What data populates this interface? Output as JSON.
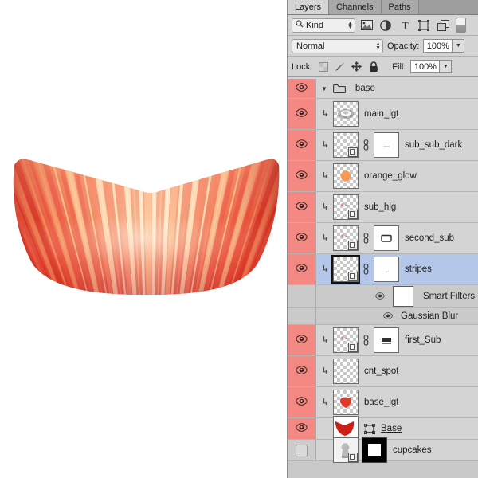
{
  "panel": {
    "tabs": [
      {
        "label": "Layers",
        "active": true
      },
      {
        "label": "Channels",
        "active": false
      },
      {
        "label": "Paths",
        "active": false
      }
    ],
    "filter": {
      "kind_label": "Kind",
      "search_icon": "magnifier-icon",
      "icons": [
        "image-filter-icon",
        "adjustment-filter-icon",
        "type-filter-icon",
        "shape-filter-icon",
        "smart-object-filter-icon"
      ],
      "toggle_name": "filter-enable-toggle"
    },
    "blend": {
      "mode": "Normal",
      "opacity_label": "Opacity:",
      "opacity_value": "100%",
      "fill_label": "Fill:",
      "fill_value": "100%"
    },
    "lock": {
      "label": "Lock:",
      "items": [
        "lock-transparent-pixels-icon",
        "lock-image-pixels-icon",
        "lock-position-icon",
        "lock-all-icon"
      ]
    }
  },
  "layers": [
    {
      "name": "base",
      "type": "group",
      "visible": true,
      "expanded": true,
      "clipped": false,
      "selected": false
    },
    {
      "name": "main_lgt",
      "type": "layer",
      "visible": true,
      "clipped": true,
      "selected": false,
      "has_thumb": true,
      "thumb_kind": "blurred-highlight",
      "smart_object": false,
      "linked": false,
      "has_mask": false
    },
    {
      "name": "sub_sub_dark",
      "type": "layer",
      "visible": true,
      "clipped": true,
      "selected": false,
      "has_thumb": true,
      "thumb_kind": "transparent",
      "smart_object": true,
      "linked": true,
      "has_mask": true,
      "mask_kind": "white-thin-line"
    },
    {
      "name": "orange_glow",
      "type": "layer",
      "visible": true,
      "clipped": true,
      "selected": false,
      "has_thumb": true,
      "thumb_kind": "orange-blob",
      "smart_object": false,
      "linked": false,
      "has_mask": false
    },
    {
      "name": "sub_hlg",
      "type": "layer",
      "visible": true,
      "clipped": true,
      "selected": false,
      "has_thumb": true,
      "thumb_kind": "faint-specks",
      "smart_object": true,
      "linked": false,
      "has_mask": false
    },
    {
      "name": "second_sub",
      "type": "layer",
      "visible": true,
      "clipped": true,
      "selected": false,
      "has_thumb": true,
      "thumb_kind": "faint-specks",
      "smart_object": true,
      "linked": true,
      "has_mask": true,
      "mask_kind": "white-rounded-rect"
    },
    {
      "name": "stripes",
      "type": "layer",
      "visible": true,
      "clipped": true,
      "selected": true,
      "has_thumb": true,
      "thumb_kind": "transparent",
      "smart_object": true,
      "linked": true,
      "has_mask": true,
      "mask_kind": "white-faint"
    },
    {
      "name": "Smart Filters",
      "type": "smart-filters",
      "visible": true
    },
    {
      "name": "Gaussian Blur",
      "type": "filter-effect",
      "visible": true
    },
    {
      "name": "first_Sub",
      "type": "layer",
      "visible": true,
      "clipped": true,
      "selected": false,
      "has_thumb": true,
      "thumb_kind": "faint-specks",
      "smart_object": true,
      "linked": true,
      "has_mask": true,
      "mask_kind": "white-bar"
    },
    {
      "name": "cnt_spot",
      "type": "layer",
      "visible": true,
      "clipped": true,
      "selected": false,
      "has_thumb": true,
      "thumb_kind": "transparent",
      "smart_object": false,
      "linked": false,
      "has_mask": false
    },
    {
      "name": "base_lgt",
      "type": "layer",
      "visible": true,
      "clipped": true,
      "selected": false,
      "has_thumb": true,
      "thumb_kind": "red-blob",
      "smart_object": false,
      "linked": false,
      "has_mask": false
    },
    {
      "name": "Base",
      "type": "layer",
      "visible": true,
      "clipped": false,
      "selected": false,
      "underlined": true,
      "has_thumb": true,
      "thumb_kind": "red-cup",
      "vector_mask": true,
      "smart_object": false,
      "linked": false,
      "has_mask": false
    },
    {
      "name": "cupcakes",
      "type": "layer",
      "visible": false,
      "clipped": false,
      "selected": false,
      "has_thumb": true,
      "thumb_kind": "photo-grey",
      "smart_object": true,
      "linked": false,
      "has_mask": true,
      "mask_kind": "black-white-square"
    }
  ],
  "artwork": {
    "title": "cupcake-wrapper-striped",
    "colors": {
      "deep_red": "#d8352a",
      "red": "#e8463a",
      "orange": "#f07a45",
      "light_orange": "#f5a96a",
      "cream": "#fbd9ae",
      "highlight": "#fdeccd",
      "background": "#ffffff"
    }
  }
}
